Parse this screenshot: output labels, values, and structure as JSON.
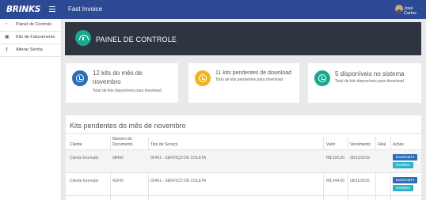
{
  "topbar": {
    "logo": "BRINKS",
    "app_title": "Fast Invoice",
    "user_name": "Josė Carlos"
  },
  "sidebar": {
    "items": [
      {
        "label": "Painel de Controle",
        "icon": "dashboard-icon"
      },
      {
        "label": "Kits de Faturamento",
        "icon": "folder-icon"
      },
      {
        "label": "Alterar Senha",
        "icon": "key-icon"
      }
    ]
  },
  "header": {
    "title": "PAINEL DE CONTROLE",
    "icon": "dashboard-icon",
    "color": "#2e3440",
    "icon_color": "#1aa88f"
  },
  "cards": [
    {
      "title": "12 kits do mês de novembro",
      "subtitle": "Total de kits disponíveis para download",
      "icon_color": "#2a6fb8",
      "icon": "clock-icon"
    },
    {
      "title": "11 kits pendentes de download",
      "subtitle": "Total de kits pendentes para download",
      "icon_color": "#f0b61f",
      "icon": "clock-icon"
    },
    {
      "title": "5 disponíveis no sistema",
      "subtitle": "Total de kits disponíveis para download",
      "icon_color": "#1aa88f",
      "icon": "clock-icon"
    }
  ],
  "list": {
    "title": "Kits pendentes do mês de novembro",
    "headers": {
      "cliente": "Cliente",
      "numero_l1": "Número do",
      "numero_l2": "Documento",
      "tipo": "Tipo de Serviço",
      "valor": "Valor",
      "vencimento": "Vencimento",
      "filial": "Filial",
      "acoes": "Ações"
    },
    "rows": [
      {
        "cliente": "Cliente Exemplo",
        "numero": "98456",
        "tipo": "02461 - SERVIÇO DE COLETA",
        "valor": "R$ 232,00",
        "vencimento": "30/12/2016",
        "filial": ""
      },
      {
        "cliente": "Cliente Exemplo",
        "numero": "43242",
        "tipo": "02461 - SERVIÇO DE COLETA",
        "valor": "R$ 544,00",
        "vencimento": "08/11/2016",
        "filial": ""
      }
    ],
    "download_label": "Download ▾",
    "details_label": "Detalhes"
  }
}
